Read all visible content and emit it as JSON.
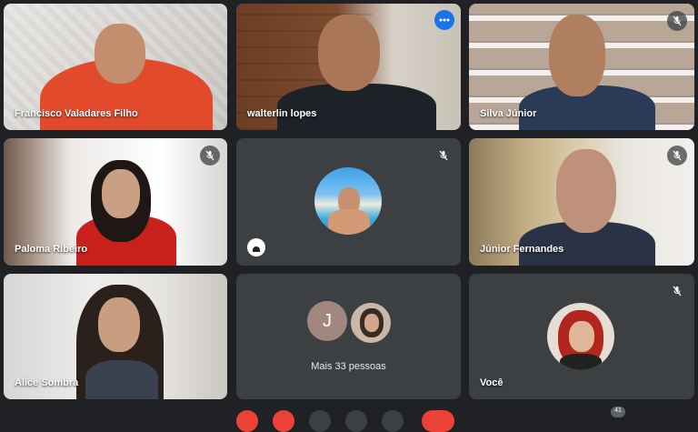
{
  "participants": [
    {
      "name": "Francisco Valadares Filho"
    },
    {
      "name": "walterlin lopes"
    },
    {
      "name": "Silva Júnior"
    },
    {
      "name": "Paloma Ribeiro"
    },
    {
      "name": ""
    },
    {
      "name": "Júnior Fernandes"
    },
    {
      "name": "Alice Sombra"
    },
    {
      "name": ""
    },
    {
      "name": "Você"
    }
  ],
  "overflow": {
    "initial": "J",
    "label": "Mais 33 pessoas"
  },
  "bottom": {
    "count": "41"
  },
  "icons": {
    "mic_off": "mic-off-icon",
    "more": "more-options-icon"
  },
  "colors": {
    "accent": "#1a73e8",
    "active_border": "#8ab4f8",
    "tile": "#3c4043",
    "background": "#202124"
  }
}
